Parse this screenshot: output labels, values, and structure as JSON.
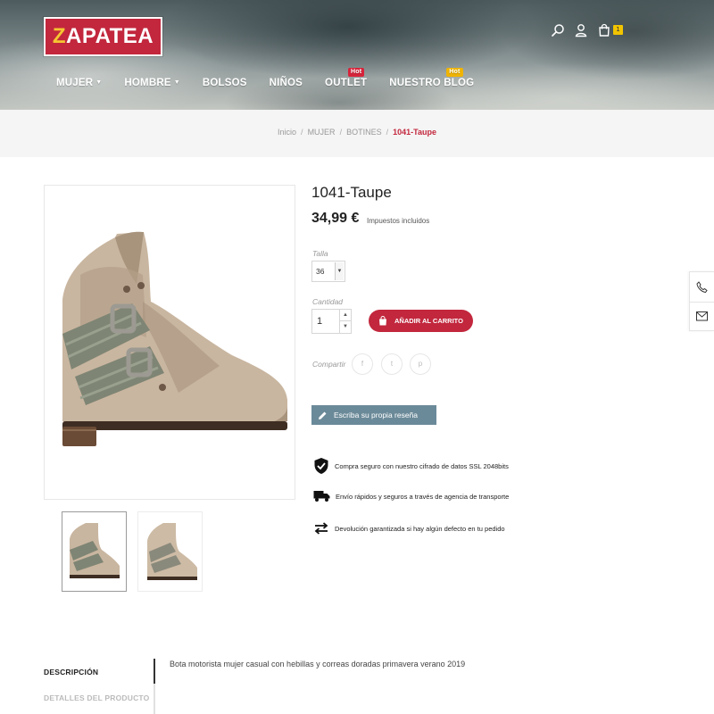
{
  "header": {
    "logo": {
      "first_letter": "Z",
      "rest": "APATEA"
    },
    "cart_count": "1",
    "icons": [
      "search-icon",
      "user-icon",
      "cart-icon"
    ],
    "nav": [
      {
        "label": "MUJER",
        "has_dropdown": true
      },
      {
        "label": "HOMBRE",
        "has_dropdown": true
      },
      {
        "label": "BOLSOS"
      },
      {
        "label": "NIÑOS"
      },
      {
        "label": "OUTLET",
        "badge": "Hot"
      },
      {
        "label": "NUESTRO BLOG",
        "badge": "Hot"
      }
    ]
  },
  "breadcrumb": [
    "Inicio",
    "MUJER",
    "BOTINES",
    "1041-Taupe"
  ],
  "product": {
    "name": "1041-Taupe",
    "price": "34,99 €",
    "tax_note": "Impuestos incluidos",
    "size_label": "Talla",
    "size_value": "36",
    "qty_label": "Cantidad",
    "qty_value": "1",
    "add_to_cart": "AÑADIR AL CARRITO",
    "share_label": "Compartir",
    "share": [
      {
        "name": "facebook",
        "glyph": "f"
      },
      {
        "name": "twitter",
        "glyph": "t"
      },
      {
        "name": "pinterest",
        "glyph": "p"
      }
    ],
    "review_button": "Escriba su propia reseña"
  },
  "reassurance": [
    {
      "icon": "shield-check-icon",
      "text": "Compra seguro con nuestro cifrado de datos SSL 2048bits"
    },
    {
      "icon": "truck-icon",
      "text": "Envío rápidos y seguros a través de agencia de transporte"
    },
    {
      "icon": "exchange-icon",
      "text": "Devolución garantizada si hay algún defecto en tu pedido"
    }
  ],
  "tabs": {
    "description_label": "DESCRIPCIÓN",
    "details_label": "DETALLES DEL PRODUCTO",
    "description_text": "Bota motorista mujer casual con hebillas y correas doradas primavera verano 2019"
  },
  "colors": {
    "brand_red": "#c2273d",
    "logo_letter": "#f5c531",
    "cart_badge": "#f2c400",
    "review_button": "#6b8a99"
  }
}
